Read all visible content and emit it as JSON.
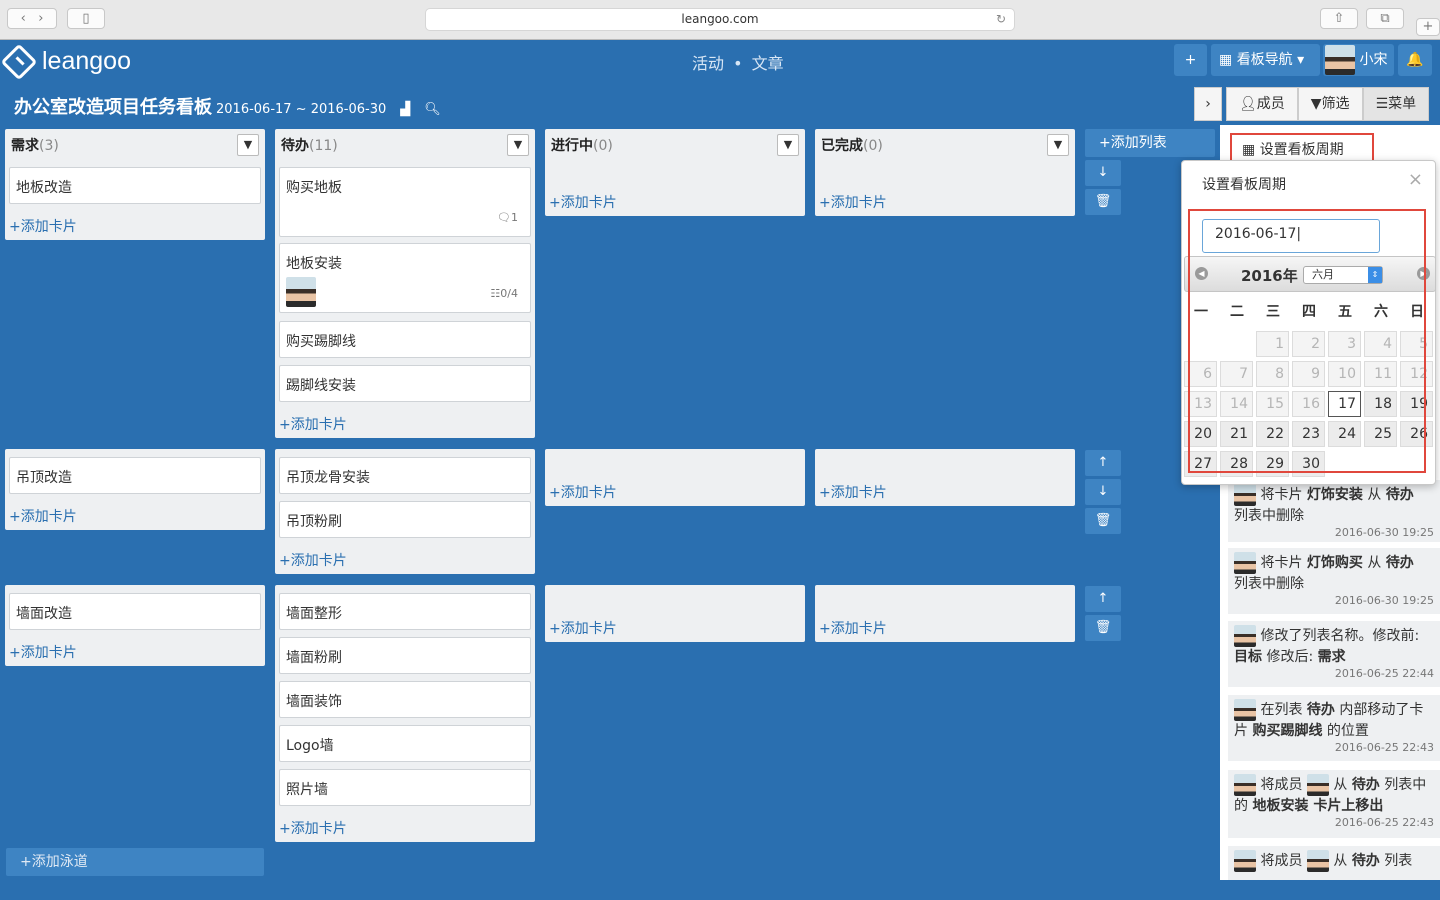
{
  "browser": {
    "url": "leangoo.com",
    "reload_icon": "reload-icon"
  },
  "header": {
    "logo": "leangoo",
    "nav": [
      "活动",
      "•",
      "文章"
    ],
    "add": "+",
    "board_nav": "看板导航",
    "user": "小宋"
  },
  "board": {
    "title": "办公室改造项目任务看板",
    "dates": "2016-06-17 ~ 2016-06-30"
  },
  "toolbar": {
    "members": "成员",
    "filter": "筛选",
    "menu": "菜单"
  },
  "lists": [
    {
      "name": "需求",
      "count": "(3)"
    },
    {
      "name": "待办",
      "count": "(11)"
    },
    {
      "name": "进行中",
      "count": "(0)"
    },
    {
      "name": "已完成",
      "count": "(0)"
    }
  ],
  "add_card": "添加卡片",
  "add_list": "添加列表",
  "add_lane": "添加泳道",
  "lanes": [
    {
      "req": [
        "地板改造"
      ],
      "todo": [
        "购买地板",
        "地板安装",
        "购买踢脚线",
        "踢脚线安装"
      ]
    },
    {
      "req": [
        "吊顶改造"
      ],
      "todo": [
        "吊顶龙骨安装",
        "吊顶粉刷"
      ]
    },
    {
      "req": [
        "墙面改造"
      ],
      "todo": [
        "墙面整形",
        "墙面粉刷",
        "墙面装饰",
        "Logo墙",
        "照片墙"
      ]
    }
  ],
  "card_meta": {
    "comments": "1",
    "checklist": "0/4"
  },
  "panel": {
    "menu_item": "设置看板周期",
    "activities": [
      {
        "pre": "将卡片",
        "b1": "灯饰安装",
        "mid": "从",
        "b2": "待办",
        "post": "列表中删除",
        "ts": "2016-06-30 19:25"
      },
      {
        "pre": "将卡片",
        "b1": "灯饰购买",
        "mid": "从",
        "b2": "待办",
        "post": "列表中删除",
        "ts": "2016-06-30 19:25"
      },
      {
        "pre": "修改了列表名称。修改前:",
        "b1": "目标",
        "mid": "修改后:",
        "b2": "需求",
        "post": "",
        "ts": "2016-06-25 22:44"
      },
      {
        "pre": "在列表",
        "b1": "待办",
        "mid": "内部移动了卡片",
        "b2": "购买踢脚线",
        "post": "的位置",
        "ts": "2016-06-25 22:43"
      },
      {
        "pre": "将成员",
        "b1": "从",
        "mid": "待办",
        "b2": "列表中的",
        "post": "地板安装 卡片上移出",
        "ts": "2016-06-25 22:43"
      },
      {
        "pre": "将成员",
        "b1": "从",
        "mid": "待办",
        "b2": "列表",
        "post": "",
        "ts": ""
      }
    ]
  },
  "popup": {
    "title": "设置看板周期",
    "close": "×",
    "date_value": "2016-06-17",
    "year": "2016年",
    "month": "六月",
    "weekdays": [
      "一",
      "二",
      "三",
      "四",
      "五",
      "六",
      "日"
    ]
  }
}
